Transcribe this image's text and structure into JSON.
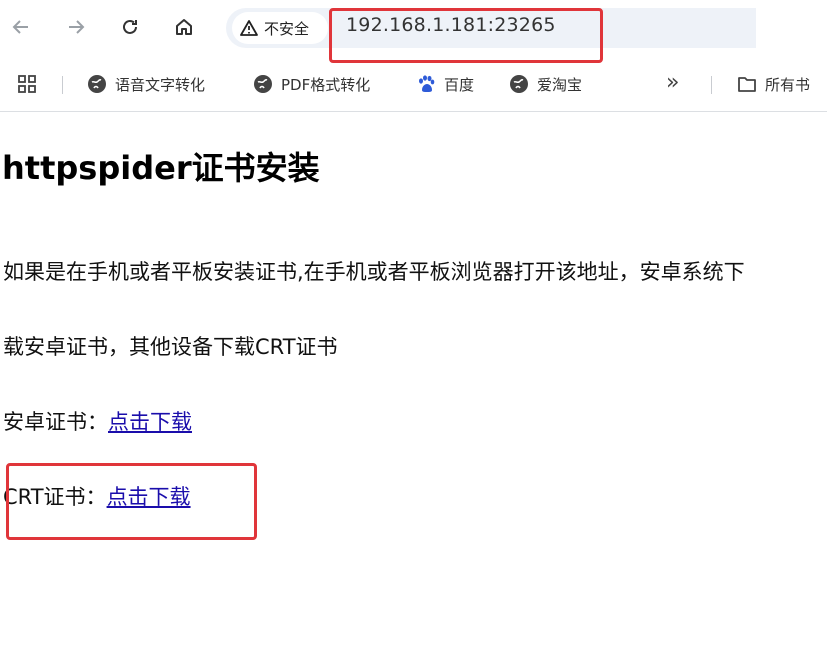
{
  "browser": {
    "security_label": "不安全",
    "url": "192.168.1.181:23265",
    "bookmarks": [
      {
        "label": "语音文字转化",
        "icon": "globe-icon"
      },
      {
        "label": "PDF格式转化",
        "icon": "globe-icon"
      },
      {
        "label": "百度",
        "icon": "baidu-paw-icon"
      },
      {
        "label": "爱淘宝",
        "icon": "globe-icon"
      }
    ],
    "more_label": "»",
    "all_bookmarks_label": "所有书"
  },
  "page": {
    "title": "httpspider证书安装",
    "instruction_line1": "如果是在手机或者平板安装证书,在手机或者平板浏览器打开该地址，安卓系统下",
    "instruction_line2": "载安卓证书，其他设备下载CRT证书",
    "android_label": "安卓证书：",
    "android_link": "点击下载",
    "crt_label": "CRT证书：",
    "crt_link": "点击下载"
  },
  "colors": {
    "annotation": "#e0353a",
    "link": "#1a0dab"
  }
}
